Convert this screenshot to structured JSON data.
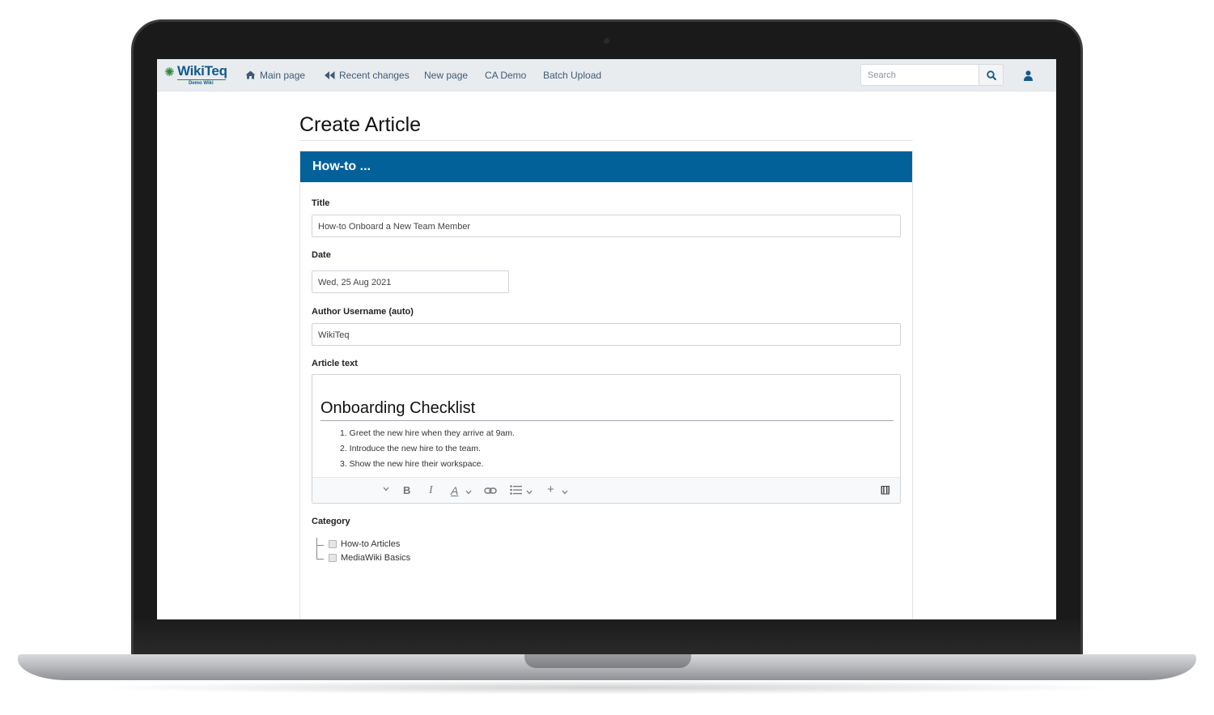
{
  "nav": {
    "logo": {
      "name_part1": "Wiki",
      "name_part2": "Teq",
      "subtitle": "Demo Wiki"
    },
    "items": [
      {
        "label": "Main page",
        "icon": "home-icon"
      },
      {
        "label": "Recent changes",
        "icon": "backward-icon"
      },
      {
        "label": "New page"
      },
      {
        "label": "CA Demo"
      },
      {
        "label": "Batch Upload"
      }
    ],
    "search": {
      "placeholder": "Search"
    }
  },
  "page": {
    "title": "Create Article"
  },
  "form": {
    "header": "How-to ...",
    "title_label": "Title",
    "title_value": "How-to Onboard a New Team Member",
    "date_label": "Date",
    "date_value": "Wed, 25 Aug 2021",
    "author_label": "Author Username (auto)",
    "author_value": "WikiTeq",
    "article_label": "Article text",
    "editor": {
      "heading": "Onboarding Checklist",
      "items": [
        "1. Greet the new hire when they arrive at 9am.",
        "2. Introduce the new hire to the team.",
        "3. Show the new hire their workspace."
      ],
      "toolbar": {
        "bold": "B",
        "italic": "I",
        "style": "A",
        "add": "+",
        "source": "[[]]"
      }
    },
    "category_label": "Category",
    "categories": [
      "How-to Articles",
      "MediaWiki Basics"
    ]
  },
  "colors": {
    "header_blue": "#03619a",
    "nav_bg": "#e9ecef",
    "nav_text": "#3f5a76",
    "logo_blue": "#135a8c",
    "logo_green": "#2a8a3c"
  }
}
